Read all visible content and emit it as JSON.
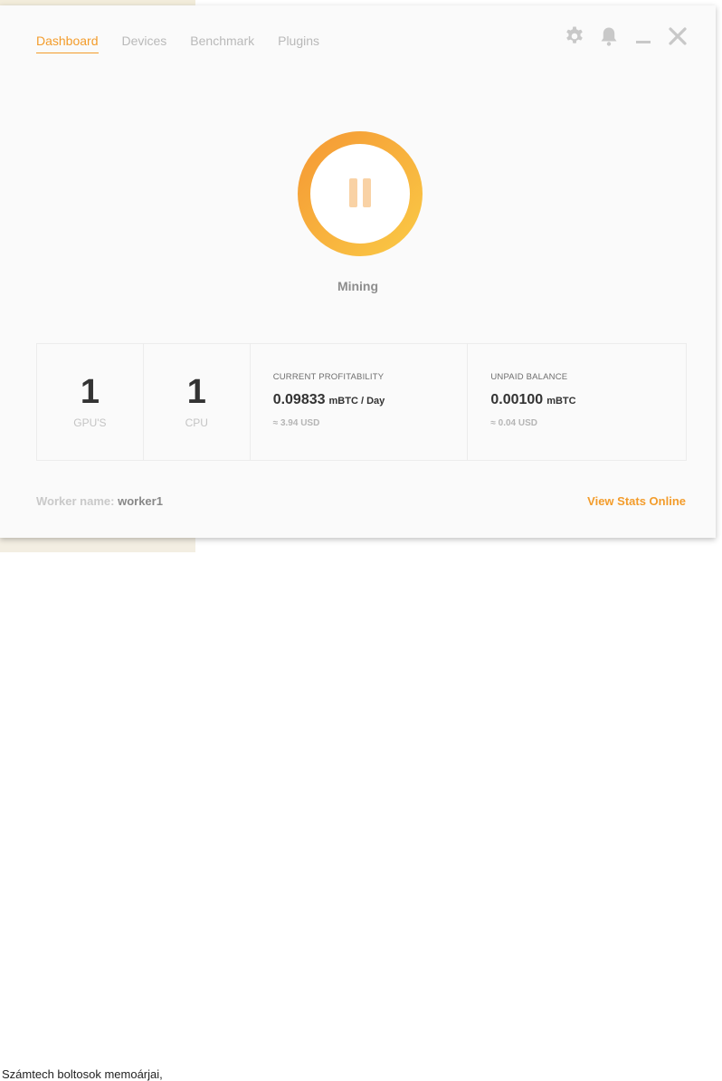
{
  "background": {
    "top_text": "[~~] ~~ ~ ~~ ~ ~",
    "bottom_text": "Számtech boltosok memoárjai,"
  },
  "tabs": [
    {
      "label": "Dashboard",
      "active": true
    },
    {
      "label": "Devices",
      "active": false
    },
    {
      "label": "Benchmark",
      "active": false
    },
    {
      "label": "Plugins",
      "active": false
    }
  ],
  "window_controls": [
    "gear-icon",
    "bell-icon",
    "minimize-icon",
    "close-icon"
  ],
  "mining": {
    "status": "Mining",
    "button_icon": "pause-icon"
  },
  "stats": {
    "gpus": {
      "value": "1",
      "label": "GPU'S"
    },
    "cpus": {
      "value": "1",
      "label": "CPU"
    },
    "profitability": {
      "title": "CURRENT PROFITABILITY",
      "value": "0.09833",
      "unit": "mBTC / Day",
      "usd": "≈ 3.94 USD"
    },
    "balance": {
      "title": "UNPAID BALANCE",
      "value": "0.00100",
      "unit": "mBTC",
      "usd": "≈ 0.04 USD"
    }
  },
  "footer": {
    "worker_label": "Worker name:",
    "worker_value": "worker1",
    "stats_link": "View Stats Online"
  },
  "colors": {
    "accent": "#f39c2b",
    "ring_start": "#f7a23b",
    "ring_end": "#f9c541",
    "pause": "#f9d4a8"
  }
}
